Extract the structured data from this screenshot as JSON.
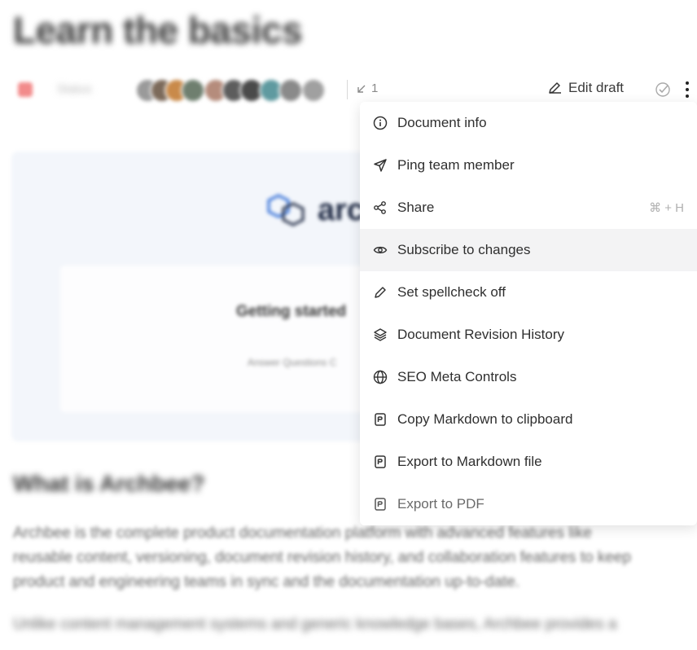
{
  "page": {
    "title": "Learn the basics",
    "section_heading": "What is Archbee?",
    "paragraph_lines": [
      "Archbee is the complete product documentation platform with advanced features like",
      "reusable content, versioning, document revision history, and collaboration features to keep",
      "product and engineering teams in sync and the documentation up-to-date.",
      "Unlike content management systems and generic knowledge bases, Archbee provides a"
    ]
  },
  "toolbar": {
    "status_label": "Status",
    "backlinks_count": "1",
    "edit_draft_label": "Edit draft"
  },
  "preview": {
    "logo_text": "archbee",
    "heading": "Getting started",
    "callout": "Answer Questions C"
  },
  "menu": {
    "items": [
      {
        "label": "Document info",
        "icon": "info-icon"
      },
      {
        "label": "Ping team member",
        "icon": "send-icon"
      },
      {
        "label": "Share",
        "icon": "share-icon",
        "shortcut": "⌘ + H"
      },
      {
        "label": "Subscribe to changes",
        "icon": "eye-icon"
      },
      {
        "label": "Set spellcheck off",
        "icon": "pencil-icon"
      },
      {
        "label": "Document Revision History",
        "icon": "layers-icon"
      },
      {
        "label": "SEO Meta Controls",
        "icon": "globe-icon"
      },
      {
        "label": "Copy Markdown to clipboard",
        "icon": "markdown-icon"
      },
      {
        "label": "Export to Markdown file",
        "icon": "markdown-file-icon"
      },
      {
        "label": "Export to PDF",
        "icon": "pdf-icon"
      }
    ]
  },
  "colors": {
    "accent_status": "#f28b8b",
    "menu_hover": "#f3f3f4"
  }
}
